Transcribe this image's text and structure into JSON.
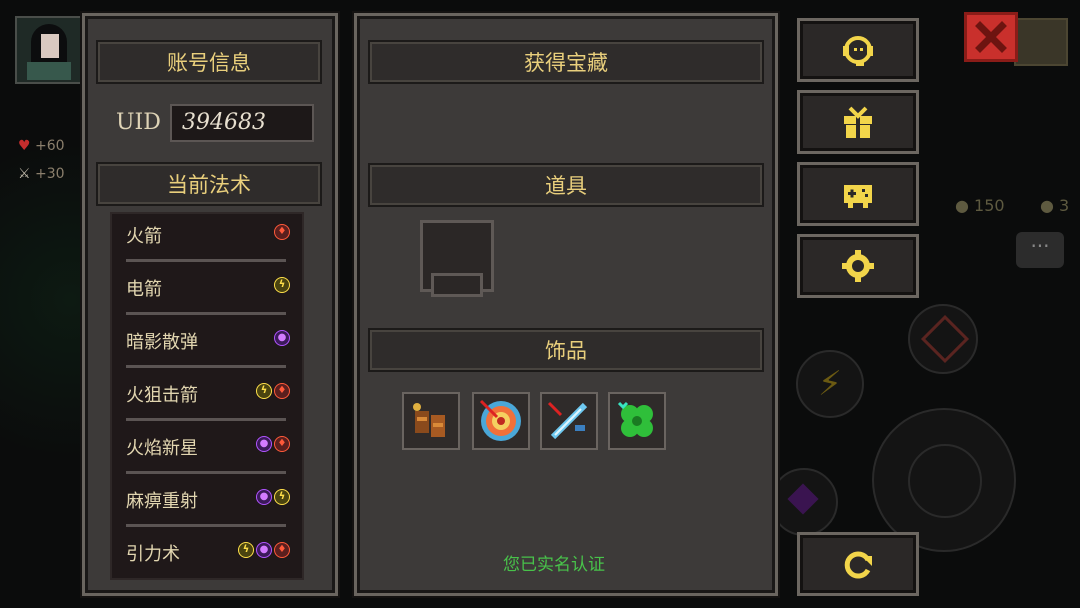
{
  "left_panel": {
    "title": "账号信息",
    "uid_label": "UID",
    "uid_value": "394683",
    "spells_title": "当前法术",
    "spells": [
      {
        "name": "火箭",
        "elements": [
          "fire"
        ]
      },
      {
        "name": "电箭",
        "elements": [
          "elec"
        ]
      },
      {
        "name": "暗影散弹",
        "elements": [
          "shadow"
        ]
      },
      {
        "name": "火狙击箭",
        "elements": [
          "elec",
          "fire"
        ]
      },
      {
        "name": "火焰新星",
        "elements": [
          "shadow",
          "fire"
        ]
      },
      {
        "name": "麻痹重射",
        "elements": [
          "shadow",
          "elec"
        ]
      },
      {
        "name": "引力术",
        "elements": [
          "elec",
          "shadow",
          "fire"
        ]
      }
    ]
  },
  "middle_panel": {
    "treasure_title": "获得宝藏",
    "items_title": "道具",
    "accessories_title": "饰品",
    "accessories": [
      "leather-bracers-icon",
      "archery-target-icon",
      "ice-dagger-icon",
      "green-clover-icon"
    ],
    "realname_status": "您已实名认证"
  },
  "sidebar": {
    "buttons": [
      {
        "name": "support-button",
        "icon": "headset-icon"
      },
      {
        "name": "gift-button",
        "icon": "gift-icon"
      },
      {
        "name": "gamepad-button",
        "icon": "gamepad-icon"
      },
      {
        "name": "settings-button",
        "icon": "gear-icon"
      },
      {
        "name": "refresh-button",
        "icon": "refresh-icon"
      }
    ]
  },
  "background": {
    "stat_hp": "+60",
    "stat_atk": "+30",
    "coins_a": "150",
    "coins_b": "3"
  },
  "colors": {
    "title_gold": "#e9cf7c",
    "fire": "#ff5a3a",
    "electric": "#ffe04a",
    "shadow": "#b054ff",
    "verified_green": "#48c24a",
    "close_red": "#c9302c"
  }
}
